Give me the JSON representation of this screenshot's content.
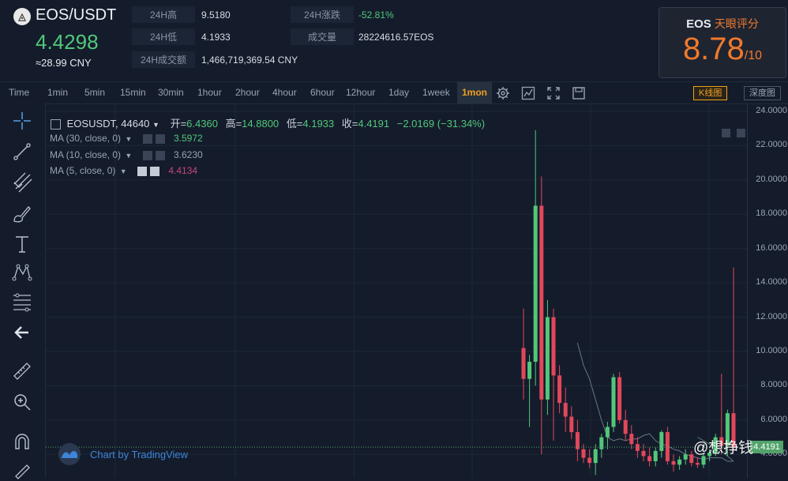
{
  "header": {
    "pair": "EOS/USDT",
    "price": "4.4298",
    "cny": "≈28.99 CNY",
    "stats": [
      {
        "label": "24H高",
        "value": "9.5180"
      },
      {
        "label": "24H低",
        "value": "4.1933"
      },
      {
        "label": "24H成交额",
        "value": "1,466,719,369.54 CNY"
      },
      {
        "label": "24H涨跌",
        "value": "-52.81%"
      },
      {
        "label": "成交量",
        "value": "28224616.57EOS"
      }
    ],
    "score": {
      "coin": "EOS",
      "label": "天眼评分",
      "value": "8.78",
      "max": "/10"
    }
  },
  "toolbar": {
    "timeframes": [
      "Time",
      "1min",
      "5min",
      "15min",
      "30min",
      "1hour",
      "2hour",
      "4hour",
      "6hour",
      "12hour",
      "1day",
      "1week",
      "1mon"
    ],
    "active": "1mon",
    "kline_button": "K线图",
    "depth_button": "深度图"
  },
  "legend": {
    "symbol": "EOSUSDT, 44640",
    "open_label": "开=",
    "open": "6.4360",
    "high_label": "高=",
    "high": "14.8800",
    "low_label": "低=",
    "low": "4.1933",
    "close_label": "收=",
    "close": "4.4191",
    "change": "−2.0169 (−31.34%)",
    "ma30": {
      "label": "MA (30, close, 0)",
      "value": "3.5972"
    },
    "ma10": {
      "label": "MA (10, close, 0)",
      "value": "3.6230"
    },
    "ma5": {
      "label": "MA (5, close, 0)",
      "value": "4.4134"
    }
  },
  "yaxis": [
    "24.0000",
    "22.0000",
    "20.0000",
    "18.0000",
    "16.0000",
    "14.0000",
    "12.0000",
    "10.0000",
    "8.0000",
    "6.0000",
    "4.0000"
  ],
  "current_price_tag": "4.4191",
  "attribution": "Chart by TradingView",
  "watermark": "@想挣钱",
  "colors": {
    "up": "#52c77a",
    "down": "#e2475b",
    "accent": "#f07a2b"
  },
  "chart_data": {
    "type": "candlestick",
    "title": "EOSUSDT, 44640",
    "ylim": [
      3,
      24
    ],
    "series": [
      {
        "name": "candles",
        "values": [
          [
            10.2,
            12.5,
            7.2,
            8.4
          ],
          [
            8.4,
            9.8,
            5.6,
            9.4
          ],
          [
            9.4,
            22.9,
            8.0,
            18.5
          ],
          [
            18.5,
            20.2,
            4.0,
            7.2
          ],
          [
            7.2,
            13.0,
            6.3,
            12.0
          ],
          [
            12.0,
            12.5,
            4.8,
            8.6
          ],
          [
            8.6,
            9.2,
            6.4,
            7.0
          ],
          [
            7.0,
            7.9,
            5.3,
            6.2
          ],
          [
            6.2,
            6.8,
            4.9,
            5.3
          ],
          [
            5.3,
            6.0,
            3.6,
            4.3
          ],
          [
            4.3,
            4.6,
            3.5,
            3.8
          ],
          [
            3.8,
            4.3,
            3.2,
            3.5
          ],
          [
            3.5,
            4.6,
            2.8,
            4.3
          ],
          [
            4.3,
            5.2,
            3.8,
            5.0
          ],
          [
            5.0,
            5.9,
            4.3,
            5.6
          ],
          [
            5.6,
            8.7,
            5.3,
            8.5
          ],
          [
            8.5,
            8.8,
            5.8,
            6.0
          ],
          [
            6.0,
            6.6,
            4.8,
            5.2
          ],
          [
            5.2,
            5.7,
            4.3,
            4.6
          ],
          [
            4.6,
            5.0,
            3.8,
            4.2
          ],
          [
            4.2,
            4.6,
            3.6,
            3.9
          ],
          [
            3.9,
            4.4,
            3.3,
            3.6
          ],
          [
            3.6,
            4.4,
            3.3,
            4.2
          ],
          [
            4.2,
            5.4,
            3.8,
            5.3
          ],
          [
            5.3,
            5.6,
            3.4,
            3.6
          ],
          [
            3.6,
            4.0,
            3.0,
            3.4
          ],
          [
            3.4,
            3.9,
            3.1,
            3.7
          ],
          [
            3.7,
            4.3,
            3.4,
            4.0
          ],
          [
            4.0,
            4.2,
            3.3,
            3.5
          ],
          [
            3.5,
            3.8,
            3.2,
            3.4
          ],
          [
            3.4,
            4.1,
            3.2,
            3.9
          ],
          [
            3.9,
            4.3,
            3.6,
            4.1
          ],
          [
            4.1,
            5.2,
            3.9,
            5.0
          ],
          [
            5.0,
            8.7,
            4.0,
            4.5
          ],
          [
            4.5,
            6.6,
            3.9,
            6.4
          ],
          [
            6.4,
            14.9,
            4.2,
            4.42
          ]
        ]
      },
      {
        "name": "MA (30, close, 0)",
        "values": [
          null,
          null,
          null,
          null,
          null,
          null,
          null,
          null,
          null,
          null,
          null,
          null,
          null,
          null,
          null,
          null,
          null,
          null,
          null,
          null,
          null,
          null,
          null,
          null,
          null,
          null,
          null,
          null,
          null,
          5.0,
          4.8,
          4.6,
          4.4,
          4.2,
          3.9,
          3.6
        ]
      },
      {
        "name": "MA (10, close, 0)",
        "values": [
          null,
          null,
          null,
          null,
          null,
          null,
          null,
          null,
          null,
          10.5,
          9.2,
          8.4,
          7.2,
          6.0,
          5.0,
          4.8,
          4.9,
          4.8,
          4.9,
          4.9,
          5.1,
          5.2,
          4.8,
          4.6,
          4.5,
          4.3,
          4.2,
          4.0,
          3.9,
          3.8,
          3.7,
          3.8,
          3.8,
          3.8,
          3.6,
          3.6
        ]
      }
    ]
  }
}
